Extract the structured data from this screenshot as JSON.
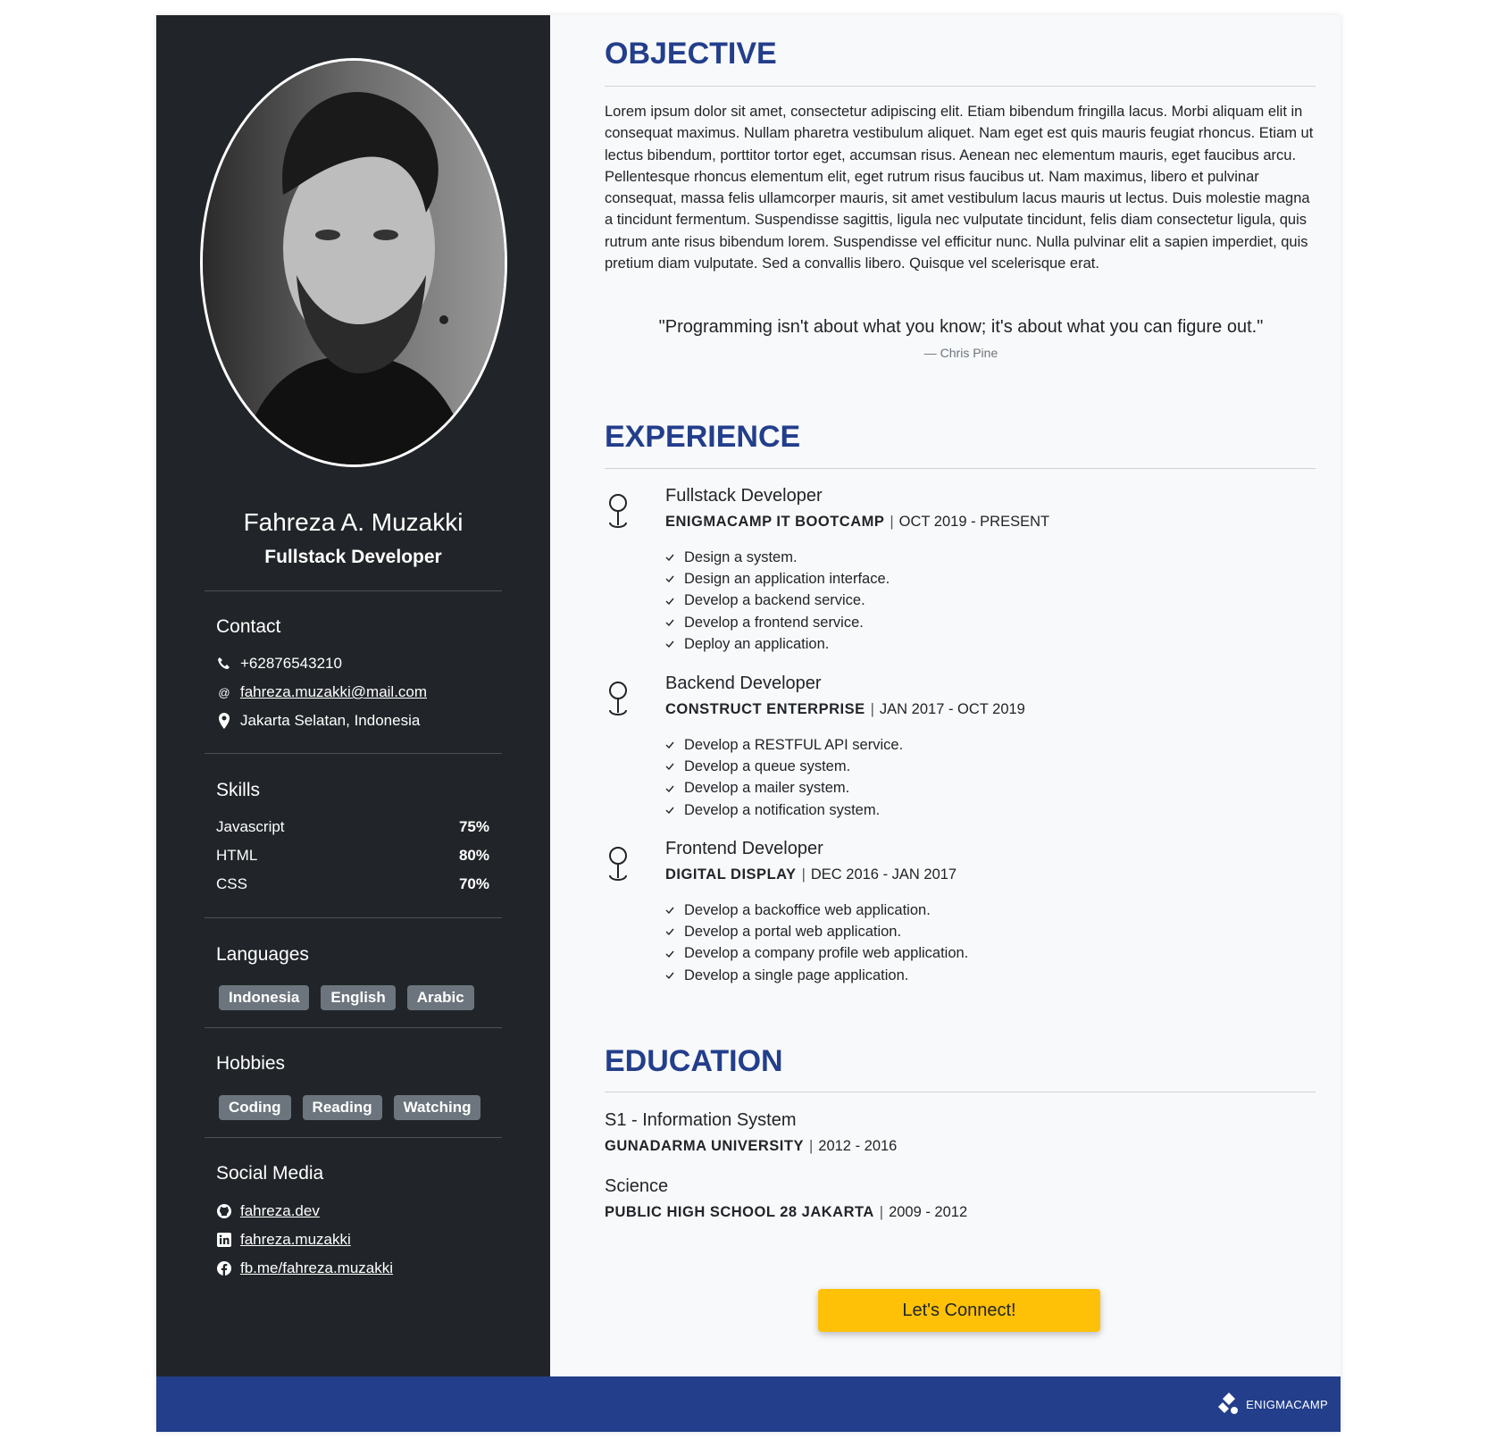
{
  "profile": {
    "name": "Fahreza A. Muzakki",
    "role": "Fullstack Developer"
  },
  "contact": {
    "title": "Contact",
    "phone": "+62876543210",
    "email": "fahreza.muzakki@mail.com",
    "location": "Jakarta Selatan, Indonesia"
  },
  "skills": {
    "title": "Skills",
    "items": [
      {
        "name": "Javascript",
        "percent": "75%"
      },
      {
        "name": "HTML",
        "percent": "80%"
      },
      {
        "name": "CSS",
        "percent": "70%"
      }
    ]
  },
  "languages": {
    "title": "Languages",
    "items": [
      "Indonesia",
      "English",
      "Arabic"
    ]
  },
  "hobbies": {
    "title": "Hobbies",
    "items": [
      "Coding",
      "Reading",
      "Watching"
    ]
  },
  "social": {
    "title": "Social Media",
    "github": "fahreza.dev",
    "linkedin": "fahreza.muzakki",
    "facebook": "fb.me/fahreza.muzakki"
  },
  "objective": {
    "title": "OBJECTIVE",
    "text": "Lorem ipsum dolor sit amet, consectetur adipiscing elit. Etiam bibendum fringilla lacus. Morbi aliquam elit in consequat maximus. Nullam pharetra vestibulum aliquet. Nam eget est quis mauris feugiat rhoncus. Etiam ut lectus bibendum, porttitor tortor eget, accumsan risus. Aenean nec elementum mauris, eget faucibus arcu. Pellentesque rhoncus elementum elit, eget rutrum risus faucibus ut. Nam maximus, libero et pulvinar consequat, massa felis ullamcorper mauris, sit amet vestibulum lacus mauris ut lectus. Duis molestie magna a tincidunt fermentum. Suspendisse sagittis, ligula nec vulputate tincidunt, felis diam consectetur ligula, quis rutrum ante risus bibendum lorem. Suspendisse vel efficitur nunc. Nulla pulvinar elit a sapien imperdiet, quis pretium diam vulputate. Sed a convallis libero. Quisque vel scelerisque erat.",
    "quote": "\"Programming isn't about what you know; it's about what you can figure out.\"",
    "quote_author": "— Chris Pine"
  },
  "experience": {
    "title": "EXPERIENCE",
    "jobs": [
      {
        "title": "Fullstack Developer",
        "org": "ENIGMACAMP IT BOOTCAMP",
        "period": "OCT 2019 - PRESENT",
        "tasks": [
          "Design a system.",
          "Design an application interface.",
          "Develop a backend service.",
          "Develop a frontend service.",
          "Deploy an application."
        ]
      },
      {
        "title": "Backend Developer",
        "org": "CONSTRUCT ENTERPRISE",
        "period": "JAN 2017 - OCT 2019",
        "tasks": [
          "Develop a RESTFUL API service.",
          "Develop a queue system.",
          "Develop a mailer system.",
          "Develop a notification system."
        ]
      },
      {
        "title": "Frontend Developer",
        "org": "DIGITAL DISPLAY",
        "period": "DEC 2016 - JAN 2017",
        "tasks": [
          "Develop a backoffice web application.",
          "Develop a portal web application.",
          "Develop a company profile web application.",
          "Develop a single page application."
        ]
      }
    ]
  },
  "education": {
    "title": "EDUCATION",
    "items": [
      {
        "degree": "S1 - Information System",
        "school": "GUNADARMA UNIVERSITY",
        "period": "2012 - 2016"
      },
      {
        "degree": "Science",
        "school": "PUBLIC HIGH SCHOOL 28 JAKARTA",
        "period": "2009 - 2012"
      }
    ]
  },
  "cta": {
    "label": "Let's Connect!"
  },
  "footer": {
    "logo_text": "ENIGMACAMP"
  },
  "colors": {
    "accent": "#233e8b",
    "sidebar": "#212529",
    "button": "#ffc107",
    "badge": "#6c757d"
  }
}
